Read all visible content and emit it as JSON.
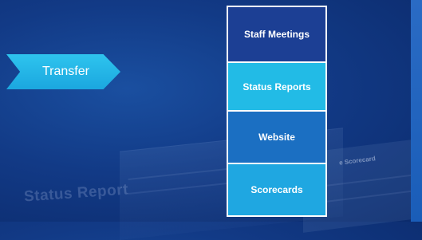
{
  "arrow": {
    "label": "Transfer"
  },
  "stack": {
    "items": [
      {
        "label": "Staff Meetings",
        "color": "#1c3f94"
      },
      {
        "label": "Status Reports",
        "color": "#22bbe6"
      },
      {
        "label": "Website",
        "color": "#1b6fc2"
      },
      {
        "label": "Scorecards",
        "color": "#1fa7e1"
      }
    ]
  },
  "background": {
    "status_report_text": "Status Report",
    "scorecard_text": "e Scorecard"
  }
}
